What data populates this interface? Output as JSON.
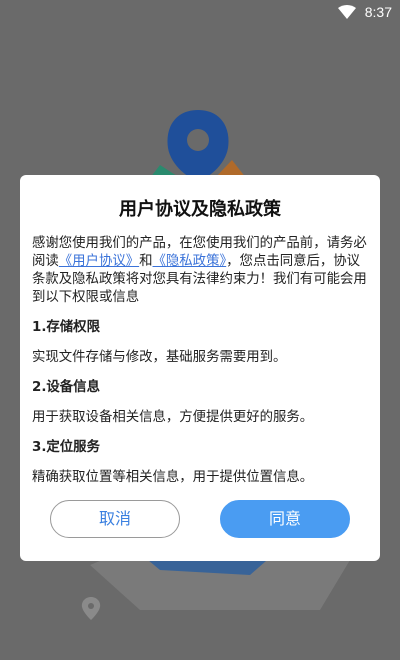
{
  "status_bar": {
    "time": "8:37",
    "wifi_icon": "wifi-icon"
  },
  "background": {
    "pin_icon": "map-pin-icon",
    "small_pin_icon": "location-pin-icon"
  },
  "dialog": {
    "title": "用户协议及隐私政策",
    "intro": {
      "part1": "感谢您使用我们的产品，在您使用我们的产品前，请务必阅读",
      "link_user_agreement": "《用户协议》",
      "conj": "和",
      "link_privacy_policy": "《隐私政策》",
      "part2": "，您点击同意后，协议条款及隐私政策将对您具有法律约束力！我们有可能会用到以下权限或信息"
    },
    "sections": [
      {
        "title": "1.存储权限",
        "text": "实现文件存储与修改，基础服务需要用到。"
      },
      {
        "title": "2.设备信息",
        "text": "用于获取设备相关信息，方便提供更好的服务。"
      },
      {
        "title": "3.定位服务",
        "text": "精确获取位置等相关信息，用于提供位置信息。"
      }
    ],
    "cancel_label": "取消",
    "agree_label": "同意"
  },
  "colors": {
    "overlay": "#6a6a6a",
    "link": "#3b73d9",
    "agree_button": "#4a9cf2",
    "cancel_text": "#3b80e0"
  }
}
